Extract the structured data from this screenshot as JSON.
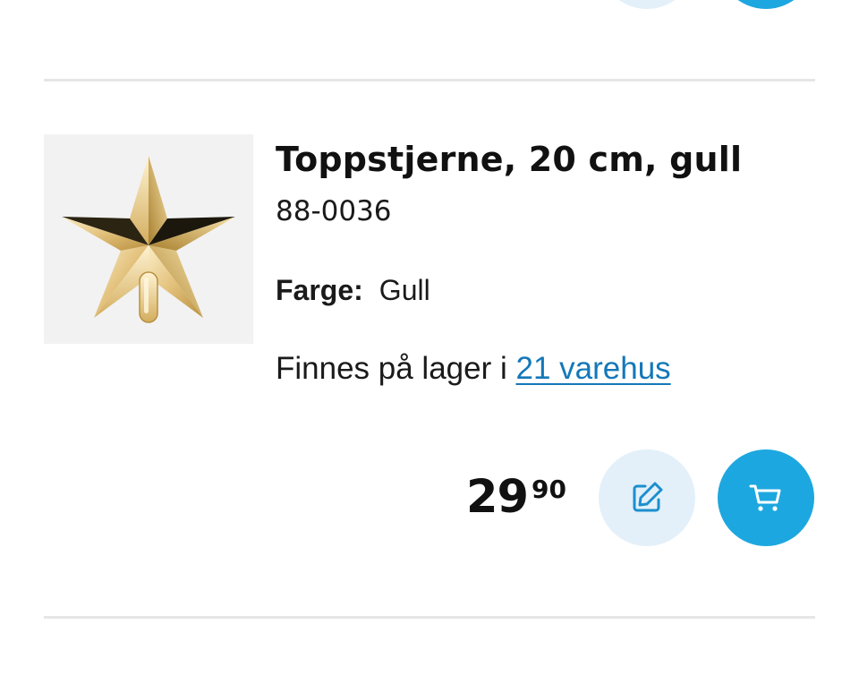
{
  "product": {
    "title": "Toppstjerne, 20 cm, gull",
    "sku": "88-0036",
    "attribute_label": "Farge:",
    "attribute_value": "Gull",
    "stock_text": "Finnes på lager i ",
    "stock_link": "21 varehus",
    "price_main": "29",
    "price_decimals": "90",
    "image_icon": "gold-star-tree-topper"
  },
  "actions": {
    "note_icon": "edit-icon",
    "cart_icon": "shopping-cart-icon"
  },
  "colors": {
    "accent": "#1da7e0",
    "accent_light": "#e3f0f9",
    "link": "#1478b8",
    "divider": "#e6e6e6"
  }
}
